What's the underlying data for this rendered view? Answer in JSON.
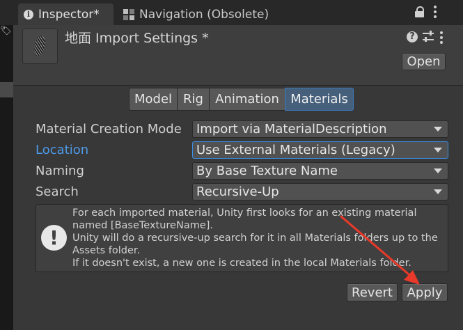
{
  "tabs": [
    {
      "label": "Inspector*",
      "icon": "info-icon"
    },
    {
      "label": "Navigation (Obsolete)",
      "icon": "navigation-icon"
    }
  ],
  "header": {
    "title": "地面 Import Settings *",
    "open_label": "Open"
  },
  "import_tabs": [
    {
      "label": "Model",
      "active": false
    },
    {
      "label": "Rig",
      "active": false
    },
    {
      "label": "Animation",
      "active": false
    },
    {
      "label": "Materials",
      "active": true
    }
  ],
  "fields": [
    {
      "label": "Material Creation Mode",
      "value": "Import via MaterialDescription"
    },
    {
      "label": "Location",
      "value": "Use External Materials (Legacy)"
    },
    {
      "label": "Naming",
      "value": "By Base Texture Name"
    },
    {
      "label": "Search",
      "value": "Recursive-Up"
    }
  ],
  "helpbox": {
    "lines": [
      "For each imported material, Unity first looks for an existing material",
      "named [BaseTextureName].",
      "Unity will do a recursive-up search for it in all Materials folders up to the",
      "Assets folder.",
      "If it doesn't exist, a new one is created in the local Materials folder."
    ]
  },
  "footer": {
    "revert_label": "Revert",
    "apply_label": "Apply"
  },
  "colors": {
    "panel_bg": "#383838",
    "accent_blue": "#4d9ae8",
    "active_tab": "#46607c",
    "annotation_arrow": "#e8392a"
  }
}
